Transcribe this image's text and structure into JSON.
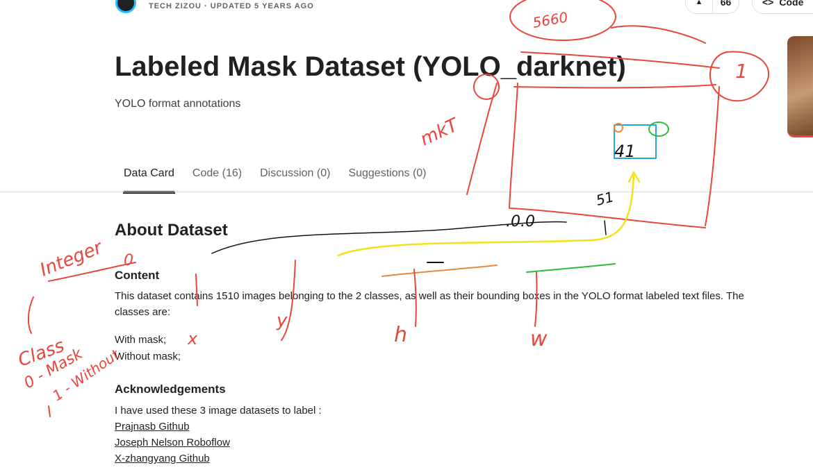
{
  "header": {
    "meta": "TECH ZIZOU · UPDATED 5 YEARS AGO",
    "vote_count": "66",
    "code_button": "Code",
    "upvote_icon": "caret-up-icon",
    "code_icon": "code-brackets-icon"
  },
  "dataset": {
    "title": "Labeled Mask Dataset (YOLO_darknet)",
    "subtitle": "YOLO format annotations"
  },
  "tabs": [
    {
      "label": "Data Card",
      "active": true
    },
    {
      "label": "Code (16)"
    },
    {
      "label": "Discussion (0)"
    },
    {
      "label": "Suggestions (0)"
    }
  ],
  "about": {
    "heading": "About Dataset",
    "content_heading": "Content",
    "content_text": "This dataset contains 1510 images belonging to the 2 classes, as well as their bounding boxes in the YOLO format labeled text files. The classes are:",
    "classes": [
      "With mask;",
      "Without mask;"
    ],
    "ack_heading": "Acknowledgements",
    "ack_intro": "I have used these 3 image datasets to label :",
    "links": [
      "Prajnasb Github",
      "Joseph Nelson Roboflow",
      "X-zhangyang Github"
    ]
  },
  "annotations": {
    "labels": [
      "5660",
      "1",
      "mkT",
      "41",
      ".0.0",
      "51",
      "Integer",
      "0",
      "x",
      "y",
      "h",
      "w",
      "Class",
      "0 - Mask",
      "1 - Without"
    ],
    "colors": {
      "red": "#e8453c",
      "black": "#111111",
      "yellow": "#f2e21a",
      "orange": "#e8883a",
      "green": "#2bbd3a",
      "blue": "#27a3e8"
    }
  }
}
